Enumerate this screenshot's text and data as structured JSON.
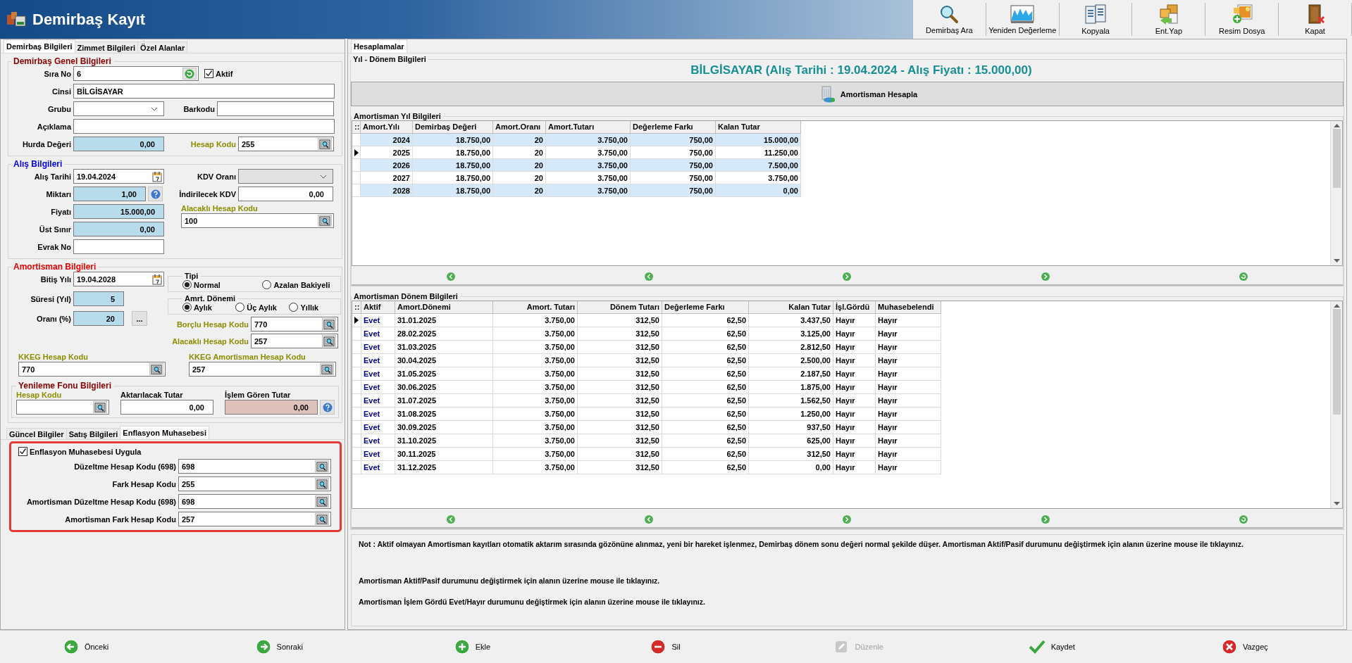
{
  "window": {
    "title": "Demirbaş Kayıt"
  },
  "toolbar": [
    {
      "label": "Demirbaş Ara"
    },
    {
      "label": "Yeniden Değerleme"
    },
    {
      "label": "Kopyala"
    },
    {
      "label": "Ent.Yap"
    },
    {
      "label": "Resim Dosya"
    },
    {
      "label": "Kapat"
    }
  ],
  "left_tabs": [
    {
      "label": "Demirbaş Bilgileri",
      "selected": true
    },
    {
      "label": "Zimmet Bilgileri",
      "selected": false
    },
    {
      "label": "Özel Alanlar",
      "selected": false
    }
  ],
  "general": {
    "title": "Demirbaş Genel Bilgileri",
    "active": {
      "label": "Aktif",
      "checked": true
    },
    "fields": [
      {
        "label": "Sıra No",
        "value": "6",
        "kind": "serial",
        "accent": false
      },
      {
        "label": "Cinsi",
        "value": "BİLGİSAYAR",
        "kind": "text",
        "accent": false
      },
      {
        "label": "Grubu",
        "kind": "combo",
        "disabled": false,
        "accent": false
      },
      {
        "label": "Barkodu",
        "kind": "text",
        "accent": false
      },
      {
        "label": "Açıklama",
        "kind": "text",
        "accent": false
      },
      {
        "label": "Hurda Değeri",
        "value": "0,00",
        "kind": "computed",
        "accent": false
      },
      {
        "label": "Hesap Kodu",
        "value": "255",
        "kind": "lookup",
        "accent": true
      }
    ]
  },
  "purchase": {
    "title": "Alış Bilgileri",
    "fields": [
      {
        "label": "Alış Tarihi",
        "value": "19.04.2024",
        "kind": "date",
        "accent": false
      },
      {
        "label": "Miktarı",
        "value": "1,00",
        "kind": "quantity",
        "accent": false
      },
      {
        "label": "Fiyatı",
        "value": "15.000,00",
        "kind": "computed",
        "accent": false
      },
      {
        "label": "Üst Sınır",
        "value": "0,00",
        "kind": "computed",
        "accent": false
      },
      {
        "label": "Evrak No",
        "kind": "text",
        "accent": false
      },
      {
        "label": "KDV Oranı",
        "kind": "combo",
        "disabled": true,
        "accent": false
      },
      {
        "label": "İndirilecek KDV",
        "value": "0,00",
        "kind": "amount",
        "accent": false
      },
      {
        "label": "Alacaklı Hesap Kodu",
        "value": "100",
        "kind": "lookup",
        "accent": true
      }
    ]
  },
  "amortization": {
    "title": "Amortisman Bilgileri",
    "more_button": "...",
    "fields": [
      {
        "label": "Bitiş Yılı",
        "value": "19.04.2028",
        "kind": "date",
        "accent": false
      },
      {
        "label": "Süresi (Yıl)",
        "value": "5",
        "kind": "computed",
        "accent": false
      },
      {
        "label": "Oranı (%)",
        "value": "20",
        "kind": "computed",
        "accent": false
      },
      {
        "label": "Borçlu Hesap Kodu",
        "value": "770",
        "kind": "lookup",
        "accent": true
      },
      {
        "label": "Alacaklı Hesap Kodu",
        "value": "257",
        "kind": "lookup",
        "accent": true
      },
      {
        "label": "KKEG Hesap Kodu",
        "value": "770",
        "kind": "lookup",
        "accent": true
      },
      {
        "label": "KKEG Amortisman Hesap Kodu",
        "value": "257",
        "kind": "lookup",
        "accent": true
      }
    ],
    "type_group": {
      "title": "Tipi",
      "options": [
        {
          "label": "Normal",
          "selected": true
        },
        {
          "label": "Azalan Bakiyeli",
          "selected": false
        }
      ]
    },
    "period_group": {
      "title": "Amrt. Dönemi",
      "options": [
        {
          "label": "Aylık",
          "selected": true
        },
        {
          "label": "Üç Aylık",
          "selected": false
        },
        {
          "label": "Yıllık",
          "selected": false
        }
      ]
    },
    "renewal": {
      "title": "Yenileme Fonu Bilgileri",
      "fields": [
        {
          "label": "Hesap Kodu",
          "kind": "lookup",
          "accent": true
        },
        {
          "label": "Aktarılacak Tutar",
          "value": "0,00",
          "kind": "amount",
          "accent": false
        },
        {
          "label": "İşlem Gören Tutar",
          "value": "0,00",
          "kind": "readonly",
          "accent": false
        }
      ]
    }
  },
  "bottom_tabs": [
    {
      "label": "Güncel Bilgiler",
      "selected": false
    },
    {
      "label": "Satış Bilgileri",
      "selected": false
    },
    {
      "label": "Enflasyon Muhasebesi",
      "selected": true
    }
  ],
  "inflation": {
    "apply": {
      "label": "Enflasyon Muhasebesi Uygula",
      "checked": true
    },
    "fields": [
      {
        "label": "Düzeltme Hesap Kodu (698)",
        "value": "698",
        "kind": "lookup",
        "accent": false
      },
      {
        "label": "Fark Hesap Kodu",
        "value": "255",
        "kind": "lookup",
        "accent": false
      },
      {
        "label": "Amortisman Düzeltme Hesap Kodu (698)",
        "value": "698",
        "kind": "lookup",
        "accent": false
      },
      {
        "label": "Amortisman Fark Hesap Kodu",
        "value": "257",
        "kind": "lookup",
        "accent": false
      }
    ]
  },
  "right_tabs": [
    {
      "label": "Hesaplamalar",
      "selected": true
    }
  ],
  "period_info": {
    "title": "Yıl - Dönem Bilgileri",
    "heading": "BİLGİSAYAR (Alış Tarihi : 19.04.2024 - Alış Fiyatı : 15.000,00)",
    "calculate_button": "Amortisman Hesapla"
  },
  "year_table": {
    "title": "Amortisman Yıl Bilgileri",
    "corner": "::",
    "columns": [
      "Amort.Yılı",
      "Demirbaş Değeri",
      "Amort.Oranı",
      "Amort.Tutarı",
      "Değerleme Farkı",
      "Kalan Tutar"
    ],
    "rows": [
      {
        "selected": false,
        "cells": [
          "2024",
          "18.750,00",
          "20",
          "3.750,00",
          "750,00",
          "15.000,00"
        ]
      },
      {
        "selected": true,
        "cells": [
          "2025",
          "18.750,00",
          "20",
          "3.750,00",
          "750,00",
          "11.250,00"
        ]
      },
      {
        "selected": false,
        "cells": [
          "2026",
          "18.750,00",
          "20",
          "3.750,00",
          "750,00",
          "7.500,00"
        ]
      },
      {
        "selected": false,
        "cells": [
          "2027",
          "18.750,00",
          "20",
          "3.750,00",
          "750,00",
          "3.750,00"
        ]
      },
      {
        "selected": false,
        "cells": [
          "2028",
          "18.750,00",
          "20",
          "3.750,00",
          "750,00",
          "0,00"
        ]
      }
    ]
  },
  "period_table": {
    "title": "Amortisman Dönem Bilgileri",
    "corner": "::",
    "columns": [
      "Aktif",
      "Amort.Dönemi",
      "Amort. Tutarı",
      "Dönem Tutarı",
      "Değerleme Farkı",
      "Kalan Tutar",
      "İşl.Gördü",
      "Muhasebelendi"
    ],
    "rows": [
      {
        "selected": true,
        "cells": [
          "Evet",
          "31.01.2025",
          "3.750,00",
          "312,50",
          "62,50",
          "3.437,50",
          "Hayır",
          "Hayır"
        ]
      },
      {
        "selected": false,
        "cells": [
          "Evet",
          "28.02.2025",
          "3.750,00",
          "312,50",
          "62,50",
          "3.125,00",
          "Hayır",
          "Hayır"
        ]
      },
      {
        "selected": false,
        "cells": [
          "Evet",
          "31.03.2025",
          "3.750,00",
          "312,50",
          "62,50",
          "2.812,50",
          "Hayır",
          "Hayır"
        ]
      },
      {
        "selected": false,
        "cells": [
          "Evet",
          "30.04.2025",
          "3.750,00",
          "312,50",
          "62,50",
          "2.500,00",
          "Hayır",
          "Hayır"
        ]
      },
      {
        "selected": false,
        "cells": [
          "Evet",
          "31.05.2025",
          "3.750,00",
          "312,50",
          "62,50",
          "2.187,50",
          "Hayır",
          "Hayır"
        ]
      },
      {
        "selected": false,
        "cells": [
          "Evet",
          "30.06.2025",
          "3.750,00",
          "312,50",
          "62,50",
          "1.875,00",
          "Hayır",
          "Hayır"
        ]
      },
      {
        "selected": false,
        "cells": [
          "Evet",
          "31.07.2025",
          "3.750,00",
          "312,50",
          "62,50",
          "1.562,50",
          "Hayır",
          "Hayır"
        ]
      },
      {
        "selected": false,
        "cells": [
          "Evet",
          "31.08.2025",
          "3.750,00",
          "312,50",
          "62,50",
          "1.250,00",
          "Hayır",
          "Hayır"
        ]
      },
      {
        "selected": false,
        "cells": [
          "Evet",
          "30.09.2025",
          "3.750,00",
          "312,50",
          "62,50",
          "937,50",
          "Hayır",
          "Hayır"
        ]
      },
      {
        "selected": false,
        "cells": [
          "Evet",
          "31.10.2025",
          "3.750,00",
          "312,50",
          "62,50",
          "625,00",
          "Hayır",
          "Hayır"
        ]
      },
      {
        "selected": false,
        "cells": [
          "Evet",
          "30.11.2025",
          "3.750,00",
          "312,50",
          "62,50",
          "312,50",
          "Hayır",
          "Hayır"
        ]
      },
      {
        "selected": false,
        "cells": [
          "Evet",
          "31.12.2025",
          "3.750,00",
          "312,50",
          "62,50",
          "0,00",
          "Hayır",
          "Hayır"
        ]
      }
    ]
  },
  "notes": [
    "Not : Aktif olmayan Amortisman kayıtları otomatik aktarım sırasında gözönüne alınmaz, yeni bir hareket işlenmez, Demirbaş dönem sonu değeri normal şekilde düşer. Amortisman Aktif/Pasif durumunu değiştirmek için alanın üzerine mouse ile tıklayınız.",
    "Amortisman Aktif/Pasif durumunu değiştirmek için alanın üzerine mouse ile tıklayınız.",
    "Amortisman İşlem Gördü Evet/Hayır durumunu değiştirmek için alanın üzerine mouse ile tıklayınız."
  ],
  "footer": [
    {
      "label": "Önceki",
      "disabled": false
    },
    {
      "label": "Sonraki",
      "disabled": false
    },
    {
      "label": "Ekle",
      "disabled": false
    },
    {
      "label": "Sil",
      "disabled": false
    },
    {
      "label": "Düzenle",
      "disabled": true
    },
    {
      "label": "Kaydet",
      "disabled": false
    },
    {
      "label": "Vazgeç",
      "disabled": false
    }
  ]
}
